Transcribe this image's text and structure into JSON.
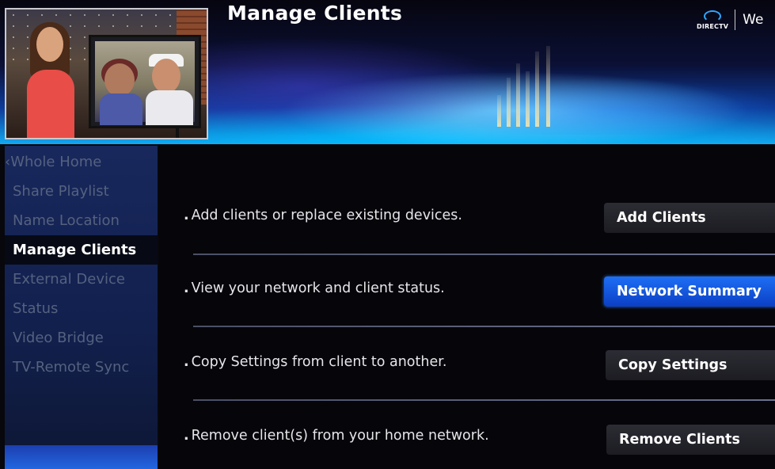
{
  "header": {
    "title": "Manage Clients",
    "logo_text": "DIRECTV",
    "welcome_text": "We"
  },
  "sidebar": {
    "items": [
      {
        "label": "‹Whole Home",
        "state": "back"
      },
      {
        "label": "Share Playlist",
        "state": "inactive"
      },
      {
        "label": "Name Location",
        "state": "inactive"
      },
      {
        "label": "Manage Clients",
        "state": "active"
      },
      {
        "label": "External Device",
        "state": "inactive"
      },
      {
        "label": "Status",
        "state": "inactive"
      },
      {
        "label": "Video Bridge",
        "state": "inactive"
      },
      {
        "label": "TV-Remote Sync",
        "state": "inactive"
      }
    ]
  },
  "main": {
    "bullet": ".",
    "rows": [
      {
        "description": "Add clients or replace existing devices.",
        "button": "Add Clients",
        "focused": false
      },
      {
        "description": "View your network and client status.",
        "button": "Network Summary",
        "focused": true
      },
      {
        "description": "Copy Settings from client to another.",
        "button": "Copy Settings",
        "focused": false
      },
      {
        "description": "Remove client(s) from your home network.",
        "button": "Remove Clients",
        "focused": false
      }
    ]
  },
  "colors": {
    "focus_blue": "#1e6ff5",
    "inactive_text": "#54617f",
    "active_text": "#ffffff",
    "sidebar_bg": "#18285c",
    "brand_blue": "#2fa6ff"
  }
}
